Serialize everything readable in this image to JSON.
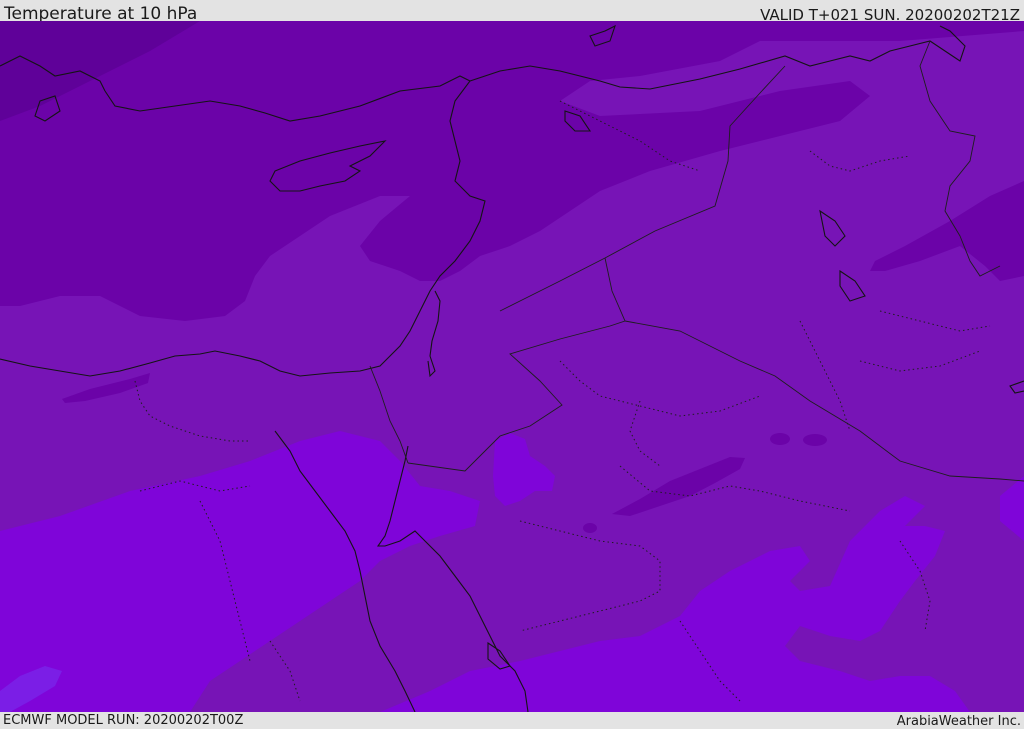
{
  "header": {
    "title": "Temperature at 10 hPa",
    "valid": "VALID T+021 SUN. 20200202T21Z"
  },
  "footer": {
    "model_run": "ECMWF MODEL RUN: 20200202T00Z",
    "brand": "ArabiaWeather Inc."
  },
  "map": {
    "colors": {
      "coldest": "#5f0199",
      "cold": "#6b03a8",
      "mid": "#7714b6",
      "warm": "#7f05d9",
      "warmest": "#7b1ee6",
      "coastline": "#141414",
      "border": "#1e1e1e"
    }
  }
}
